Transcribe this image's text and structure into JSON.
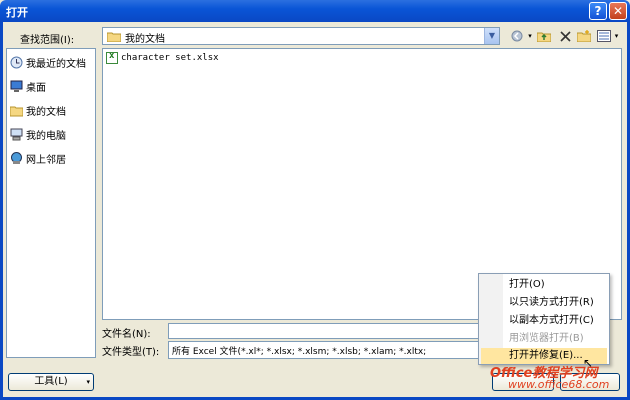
{
  "window": {
    "title": "打开",
    "help_label": "?",
    "close_label": "✕"
  },
  "lookin": {
    "label": "查找范围(I):",
    "value": "我的文档"
  },
  "places": [
    {
      "label": "我最近的文档",
      "icon": "recent-docs-icon"
    },
    {
      "label": "桌面",
      "icon": "desktop-icon"
    },
    {
      "label": "我的文档",
      "icon": "my-documents-icon"
    },
    {
      "label": "我的电脑",
      "icon": "my-computer-icon"
    },
    {
      "label": "网上邻居",
      "icon": "network-icon"
    }
  ],
  "files": [
    {
      "name": "character set.xlsx",
      "icon": "excel-file-icon"
    }
  ],
  "filename": {
    "label": "文件名(N):",
    "value": ""
  },
  "filetype": {
    "label": "文件类型(T):",
    "value": "所有 Excel 文件(*.xl*; *.xlsx; *.xlsm; *.xlsb; *.xlam; *.xltx;"
  },
  "tools_button": "工具(L)",
  "open_menu": {
    "items": [
      {
        "label": "打开(O)",
        "state": "normal"
      },
      {
        "label": "以只读方式打开(R)",
        "state": "normal"
      },
      {
        "label": "以副本方式打开(C)",
        "state": "normal"
      },
      {
        "label": "用浏览器打开(B)",
        "state": "disabled"
      },
      {
        "label": "打开并修复(E)...",
        "state": "hover"
      }
    ]
  },
  "watermark": {
    "line1": "Office教程学习网",
    "line2": "www.office68.com"
  },
  "colors": {
    "titlebar": "#0a55d6",
    "dialog_bg": "#ece9d8",
    "menu_hover": "#ffe6a0",
    "watermark": "#e04020"
  }
}
